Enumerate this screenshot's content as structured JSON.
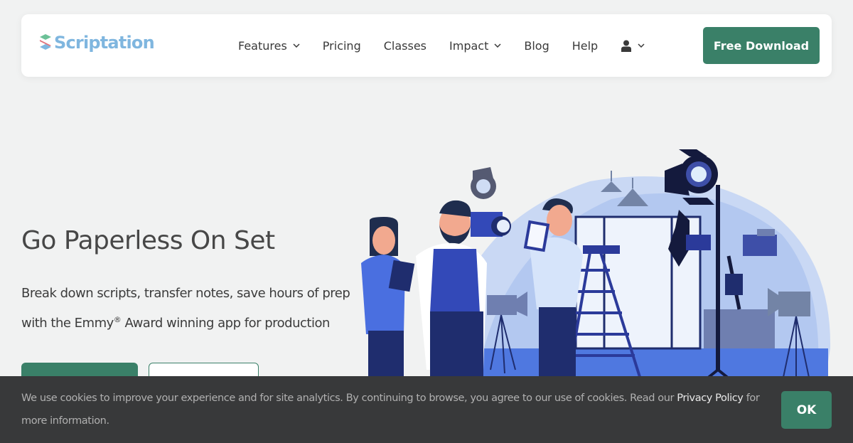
{
  "brand": {
    "name": "Scriptation",
    "accent_color": "#3a8068",
    "logo_color": "#7fb6df"
  },
  "nav": {
    "items": [
      {
        "label": "Features",
        "has_dropdown": true
      },
      {
        "label": "Pricing",
        "has_dropdown": false
      },
      {
        "label": "Classes",
        "has_dropdown": false
      },
      {
        "label": "Impact",
        "has_dropdown": true
      },
      {
        "label": "Blog",
        "has_dropdown": false
      },
      {
        "label": "Help",
        "has_dropdown": false
      }
    ],
    "account_icon": "user-icon",
    "cta_label": "Free Download"
  },
  "hero": {
    "title": "Go Paperless On Set",
    "subtitle_line1": "Break down scripts, transfer notes, save hours of prep",
    "subtitle_line2_before": "with the Emmy",
    "subtitle_reg": "®",
    "subtitle_line2_after": " Award winning app for production",
    "illustration": "film-crew-illustration"
  },
  "cookie": {
    "text_before": "We use cookies to improve your experience and for site analytics. By continuing to browse, you agree to our use of cookies. Read our ",
    "link_label": "Privacy Policy",
    "text_after": " for more information.",
    "ok_label": "OK"
  }
}
